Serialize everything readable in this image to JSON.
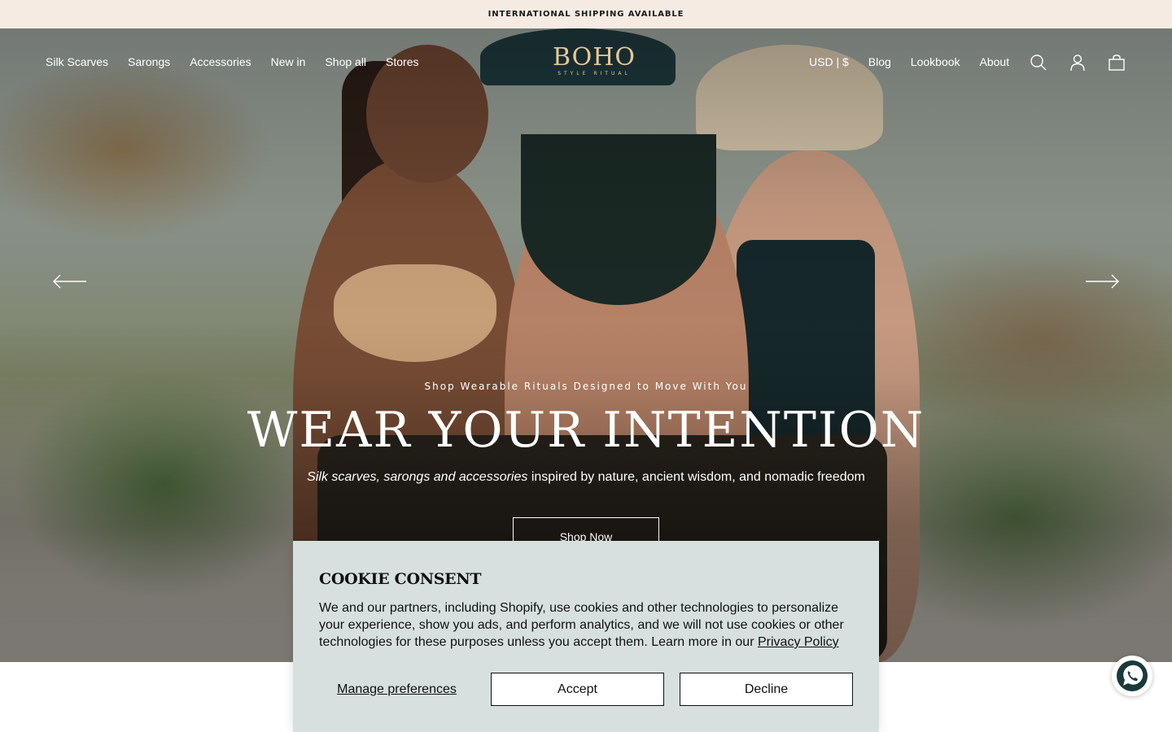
{
  "announcement": {
    "text": "INTERNATIONAL SHIPPING AVAILABLE"
  },
  "header": {
    "nav_left": [
      "Silk Scarves",
      "Sarongs",
      "Accessories",
      "New in",
      "Shop all",
      "Stores"
    ],
    "logo_text": "BOHO",
    "logo_tagline": "STYLE RITUAL",
    "currency": "USD | $",
    "nav_right": [
      "Blog",
      "Lookbook",
      "About"
    ],
    "icons": [
      "search-icon",
      "account-icon",
      "cart-icon"
    ]
  },
  "hero": {
    "eyebrow": "Shop Wearable Rituals Designed to Move With You",
    "headline": "WEAR YOUR INTENTION",
    "subline_italic": "Silk scarves, sarongs and accessories",
    "subline_rest": " inspired by nature, ancient wisdom, and nomadic freedom",
    "cta": "Shop Now",
    "prev_icon": "arrow-left-icon",
    "next_icon": "arrow-right-icon"
  },
  "cookie": {
    "title": "COOKIE CONSENT",
    "body": "We and our partners, including Shopify, use cookies and other technologies to personalize your experience, show you ads, and perform analytics, and we will not use cookies or other technologies for these purposes unless you accept them. Learn more in our ",
    "privacy_link": "Privacy Policy",
    "manage": "Manage preferences",
    "accept": "Accept",
    "decline": "Decline"
  },
  "chat": {
    "icon": "whatsapp-icon"
  },
  "colors": {
    "announcement_bg": "#f5ebe3",
    "cookie_bg": "#d7e0de",
    "logo_gold": "#e6c79a"
  }
}
